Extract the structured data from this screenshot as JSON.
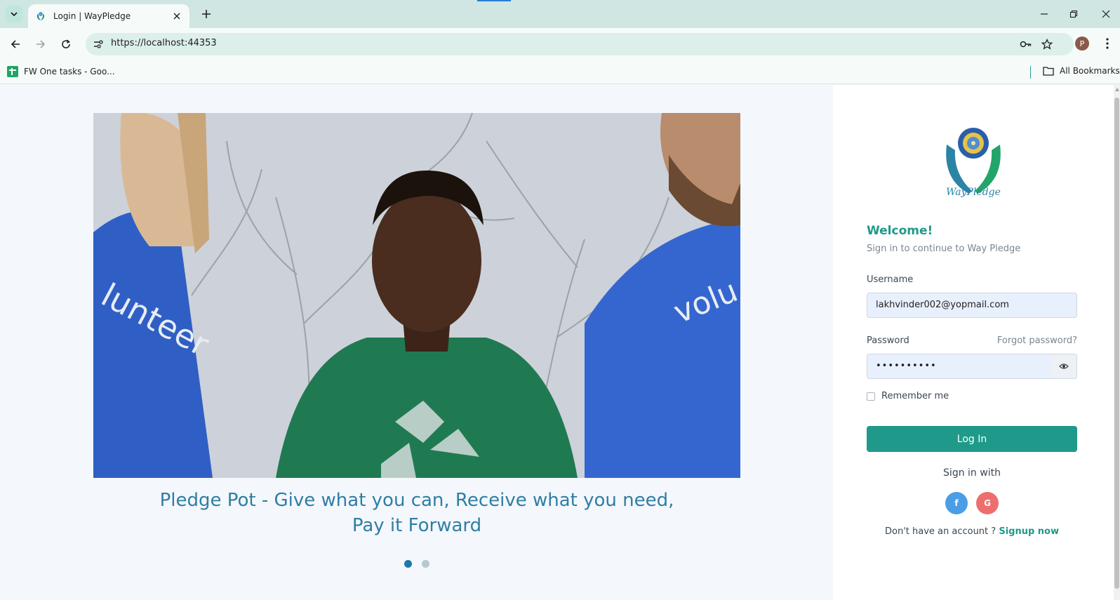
{
  "browser": {
    "tab_title": "Login | WayPledge",
    "url": "https://localhost:44353",
    "profile_initial": "P",
    "bookmarks": [
      {
        "label": "FW One tasks - Goo..."
      }
    ],
    "all_bookmarks_label": "All Bookmarks"
  },
  "hero": {
    "caption": "Pledge Pot - Give what you can, Receive what you need, Pay it Forward",
    "slide_count": 2,
    "active_slide": 1,
    "shirt_text_left": "lunteer",
    "shirt_text_right": "volu"
  },
  "login": {
    "logo_text": "WayPledge",
    "welcome": "Welcome!",
    "subtitle": "Sign in to continue to Way Pledge",
    "username_label": "Username",
    "username_value": "lakhvinder002@yopmail.com",
    "password_label": "Password",
    "password_value": "••••••••••",
    "forgot_label": "Forgot password?",
    "remember_label": "Remember me",
    "login_button": "Log In",
    "signin_with": "Sign in with",
    "facebook_icon_label": "f",
    "google_icon_label": "G",
    "no_account": "Don't have an account ? ",
    "signup_link": "Signup now"
  },
  "colors": {
    "accent": "#1f9a8a",
    "caption": "#2f7ea6",
    "facebook": "#4a9ee6",
    "google": "#ee6e6e"
  }
}
